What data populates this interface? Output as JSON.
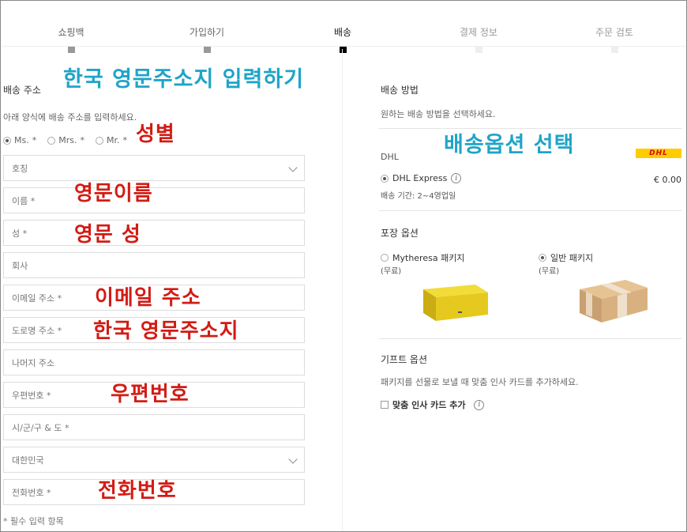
{
  "steps": [
    {
      "label": "쇼핑백",
      "state": "done"
    },
    {
      "label": "가입하기",
      "state": "done"
    },
    {
      "label": "배송",
      "state": "active"
    },
    {
      "label": "결제 정보",
      "state": "future"
    },
    {
      "label": "주문 검토",
      "state": "future"
    }
  ],
  "shipping_address": {
    "title": "배송 주소",
    "hint": "아래 양식에 배송 주소를 입력하세요.",
    "salutations": [
      {
        "label": "Ms.",
        "required": "*",
        "selected": true
      },
      {
        "label": "Mrs.",
        "required": "*",
        "selected": false
      },
      {
        "label": "Mr.",
        "required": "*",
        "selected": false
      }
    ],
    "fields": {
      "title_select": "호칭",
      "first_name": "이름 *",
      "last_name": "성 *",
      "company": "회사",
      "email": "이메일 주소 *",
      "street": "도로명 주소 *",
      "address_rest": "나머지 주소",
      "postcode": "우편번호 *",
      "city": "시/군/구 & 도  *",
      "country_select": "대한민국",
      "phone": "전화번호 *"
    },
    "required_note": "* 필수 입력 항목"
  },
  "annotations": {
    "korean_address": "한국 영문주소지 입력하기",
    "gender": "성별",
    "english_first_name": "영문이름",
    "english_last_name": "영문 성",
    "email": "이메일 주소",
    "english_address": "한국 영문주소지",
    "postcode": "우편번호",
    "phone": "전화번호",
    "shipping_option": "배송옵션 선택"
  },
  "shipping_method": {
    "title": "배송 방법",
    "hint": "원하는 배송 방법을 선택하세요.",
    "carrier": "DHL",
    "logo_text": "DHL",
    "option_label": "DHL Express",
    "price": "€ 0.00",
    "duration": "배송 기간: 2~4영업일"
  },
  "packaging": {
    "title": "포장 옵션",
    "options": [
      {
        "label": "Mytheresa 패키지",
        "price": "(무료)",
        "selected": false,
        "icon": "yellow-box-image"
      },
      {
        "label": "일반 패키지",
        "price": "(무료)",
        "selected": true,
        "icon": "cardboard-box-image"
      }
    ]
  },
  "gift": {
    "title": "기프트 옵션",
    "hint": "패키지를 선물로 보낼 때 맞춤 인사 카드를 추가하세요.",
    "checkbox_label": "맞춤 인사 카드 추가"
  },
  "colors": {
    "annotation_blue": "#1fa4c8",
    "annotation_red": "#d21c14",
    "dhl_yellow": "#ffcc00",
    "dhl_red": "#d40511"
  }
}
